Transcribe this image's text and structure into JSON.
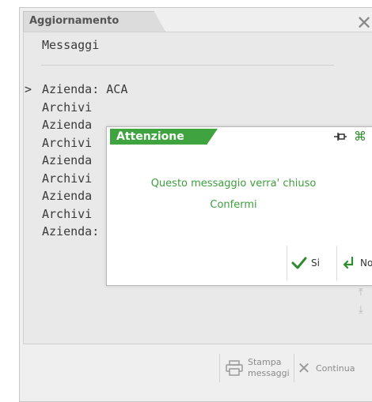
{
  "window": {
    "tab_label": "Aggiornamento"
  },
  "panel": {
    "title": "Messaggi",
    "messages": [
      {
        "marker": ">",
        "text": "Azienda: ACA"
      },
      {
        "marker": "",
        "text": "Archivi"
      },
      {
        "marker": "",
        "text": "Azienda"
      },
      {
        "marker": "",
        "text": "Archivi"
      },
      {
        "marker": "",
        "text": "Azienda"
      },
      {
        "marker": "",
        "text": "Archivi"
      },
      {
        "marker": "",
        "text": "Azienda"
      },
      {
        "marker": "",
        "text": "Archivi"
      },
      {
        "marker": "",
        "text": "Azienda: ASS"
      }
    ]
  },
  "toolbar": {
    "print_label_line1": "Stampa",
    "print_label_line2": "messaggi",
    "continue_label": "Continua"
  },
  "dialog": {
    "title": "Attenzione",
    "message_line1": "Questo messaggio verra' chiuso",
    "message_line2": "Confermi",
    "yes_label": "Si",
    "no_label": "No"
  },
  "colors": {
    "accent_green": "#3fa33f",
    "message_green": "#3e9e3e",
    "window_bg": "#efefef"
  }
}
